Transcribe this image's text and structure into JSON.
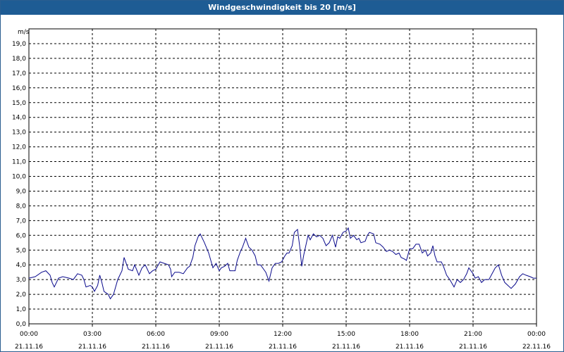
{
  "window": {
    "title": "Windgeschwindigkeit bis 20 [m/s]"
  },
  "chart_data": {
    "type": "line",
    "title": "Windgeschwindigkeit bis 20 [m/s]",
    "ylabel": "m/s",
    "xlabel": "",
    "ylim": [
      0,
      20
    ],
    "xlim_hours": [
      0,
      24
    ],
    "grid": true,
    "line_color": "#0a0a8c",
    "y_ticks": [
      "0,0",
      "1,0",
      "2,0",
      "3,0",
      "4,0",
      "5,0",
      "6,0",
      "7,0",
      "8,0",
      "9,0",
      "10,0",
      "11,0",
      "12,0",
      "13,0",
      "14,0",
      "15,0",
      "16,0",
      "17,0",
      "18,0",
      "19,0"
    ],
    "x_ticks": [
      {
        "time": "00:00",
        "date": "21.11.16"
      },
      {
        "time": "03:00",
        "date": "21.11.16"
      },
      {
        "time": "06:00",
        "date": "21.11.16"
      },
      {
        "time": "09:00",
        "date": "21.11.16"
      },
      {
        "time": "12:00",
        "date": "21.11.16"
      },
      {
        "time": "15:00",
        "date": "21.11.16"
      },
      {
        "time": "18:00",
        "date": "21.11.16"
      },
      {
        "time": "21:00",
        "date": "21.11.16"
      },
      {
        "time": "00:00",
        "date": "22.11.16"
      }
    ],
    "series": [
      {
        "points": [
          [
            0.0,
            3.1
          ],
          [
            0.3,
            3.2
          ],
          [
            0.6,
            3.5
          ],
          [
            0.8,
            3.6
          ],
          [
            1.0,
            3.3
          ],
          [
            1.1,
            2.8
          ],
          [
            1.2,
            2.5
          ],
          [
            1.4,
            3.1
          ],
          [
            1.6,
            3.2
          ],
          [
            1.9,
            3.1
          ],
          [
            2.1,
            3.0
          ],
          [
            2.3,
            3.4
          ],
          [
            2.5,
            3.3
          ],
          [
            2.6,
            3.0
          ],
          [
            2.7,
            2.5
          ],
          [
            2.9,
            2.6
          ],
          [
            3.0,
            2.5
          ],
          [
            3.1,
            2.2
          ],
          [
            3.25,
            2.6
          ],
          [
            3.35,
            3.3
          ],
          [
            3.45,
            2.8
          ],
          [
            3.55,
            2.2
          ],
          [
            3.75,
            2.0
          ],
          [
            3.85,
            1.7
          ],
          [
            4.0,
            2.0
          ],
          [
            4.2,
            3.0
          ],
          [
            4.4,
            3.6
          ],
          [
            4.5,
            4.5
          ],
          [
            4.7,
            3.7
          ],
          [
            4.9,
            3.6
          ],
          [
            5.0,
            4.0
          ],
          [
            5.2,
            3.3
          ],
          [
            5.35,
            3.8
          ],
          [
            5.5,
            4.0
          ],
          [
            5.7,
            3.4
          ],
          [
            5.85,
            3.6
          ],
          [
            6.0,
            3.7
          ],
          [
            6.2,
            4.2
          ],
          [
            6.4,
            4.1
          ],
          [
            6.6,
            4.0
          ],
          [
            6.7,
            3.7
          ],
          [
            6.75,
            3.2
          ],
          [
            6.9,
            3.5
          ],
          [
            7.1,
            3.5
          ],
          [
            7.3,
            3.4
          ],
          [
            7.5,
            3.8
          ],
          [
            7.6,
            3.9
          ],
          [
            7.75,
            4.5
          ],
          [
            7.85,
            5.3
          ],
          [
            8.0,
            5.9
          ],
          [
            8.1,
            6.1
          ],
          [
            8.3,
            5.5
          ],
          [
            8.5,
            4.8
          ],
          [
            8.6,
            4.3
          ],
          [
            8.7,
            3.8
          ],
          [
            8.85,
            4.1
          ],
          [
            9.0,
            3.6
          ],
          [
            9.1,
            3.8
          ],
          [
            9.25,
            3.9
          ],
          [
            9.4,
            4.1
          ],
          [
            9.5,
            3.6
          ],
          [
            9.6,
            3.6
          ],
          [
            9.75,
            3.6
          ],
          [
            9.85,
            4.3
          ],
          [
            10.0,
            4.9
          ],
          [
            10.1,
            5.2
          ],
          [
            10.25,
            5.8
          ],
          [
            10.4,
            5.2
          ],
          [
            10.55,
            5.0
          ],
          [
            10.7,
            4.6
          ],
          [
            10.8,
            4.0
          ],
          [
            10.95,
            4.0
          ],
          [
            11.1,
            3.7
          ],
          [
            11.2,
            3.5
          ],
          [
            11.35,
            2.9
          ],
          [
            11.5,
            3.8
          ],
          [
            11.65,
            4.1
          ],
          [
            11.8,
            4.1
          ],
          [
            11.95,
            4.2
          ],
          [
            12.1,
            4.6
          ],
          [
            12.2,
            4.8
          ],
          [
            12.3,
            4.8
          ],
          [
            12.45,
            5.3
          ],
          [
            12.55,
            6.2
          ],
          [
            12.7,
            6.4
          ],
          [
            12.8,
            5.3
          ],
          [
            12.9,
            3.9
          ],
          [
            13.0,
            4.7
          ],
          [
            13.2,
            6.0
          ],
          [
            13.3,
            5.7
          ],
          [
            13.45,
            6.1
          ],
          [
            13.6,
            5.9
          ],
          [
            13.75,
            6.0
          ],
          [
            13.9,
            5.8
          ],
          [
            14.05,
            5.3
          ],
          [
            14.2,
            5.5
          ],
          [
            14.35,
            6.0
          ],
          [
            14.5,
            5.2
          ],
          [
            14.6,
            5.9
          ],
          [
            14.7,
            5.8
          ],
          [
            14.85,
            6.2
          ],
          [
            15.0,
            6.3
          ],
          [
            15.1,
            6.5
          ],
          [
            15.2,
            5.8
          ],
          [
            15.35,
            6.0
          ],
          [
            15.5,
            5.7
          ],
          [
            15.6,
            5.8
          ],
          [
            15.7,
            5.5
          ],
          [
            15.9,
            5.6
          ],
          [
            16.0,
            6.0
          ],
          [
            16.1,
            6.2
          ],
          [
            16.3,
            6.1
          ],
          [
            16.4,
            5.5
          ],
          [
            16.6,
            5.4
          ],
          [
            16.75,
            5.2
          ],
          [
            16.9,
            4.9
          ],
          [
            17.05,
            5.0
          ],
          [
            17.2,
            4.9
          ],
          [
            17.35,
            4.7
          ],
          [
            17.5,
            4.8
          ],
          [
            17.6,
            4.5
          ],
          [
            17.75,
            4.4
          ],
          [
            17.85,
            4.3
          ],
          [
            18.0,
            5.1
          ],
          [
            18.15,
            5.1
          ],
          [
            18.3,
            5.4
          ],
          [
            18.45,
            5.4
          ],
          [
            18.6,
            4.8
          ],
          [
            18.75,
            5.0
          ],
          [
            18.85,
            4.6
          ],
          [
            19.0,
            4.8
          ],
          [
            19.1,
            5.3
          ],
          [
            19.2,
            4.6
          ],
          [
            19.3,
            4.2
          ],
          [
            19.5,
            4.2
          ],
          [
            19.6,
            3.9
          ],
          [
            19.75,
            3.3
          ],
          [
            19.9,
            3.0
          ],
          [
            20.1,
            2.5
          ],
          [
            20.25,
            3.0
          ],
          [
            20.4,
            2.8
          ],
          [
            20.55,
            3.0
          ],
          [
            20.7,
            3.4
          ],
          [
            20.8,
            3.8
          ],
          [
            21.0,
            3.4
          ],
          [
            21.1,
            3.1
          ],
          [
            21.25,
            3.2
          ],
          [
            21.4,
            2.8
          ],
          [
            21.55,
            3.0
          ],
          [
            21.75,
            3.0
          ],
          [
            21.9,
            3.4
          ],
          [
            22.05,
            3.8
          ],
          [
            22.2,
            4.0
          ],
          [
            22.35,
            3.3
          ],
          [
            22.5,
            2.8
          ],
          [
            22.65,
            2.6
          ],
          [
            22.8,
            2.4
          ],
          [
            23.0,
            2.7
          ],
          [
            23.2,
            3.2
          ],
          [
            23.35,
            3.4
          ],
          [
            23.5,
            3.3
          ],
          [
            23.7,
            3.2
          ],
          [
            23.85,
            3.1
          ],
          [
            24.0,
            3.1
          ]
        ]
      }
    ]
  }
}
